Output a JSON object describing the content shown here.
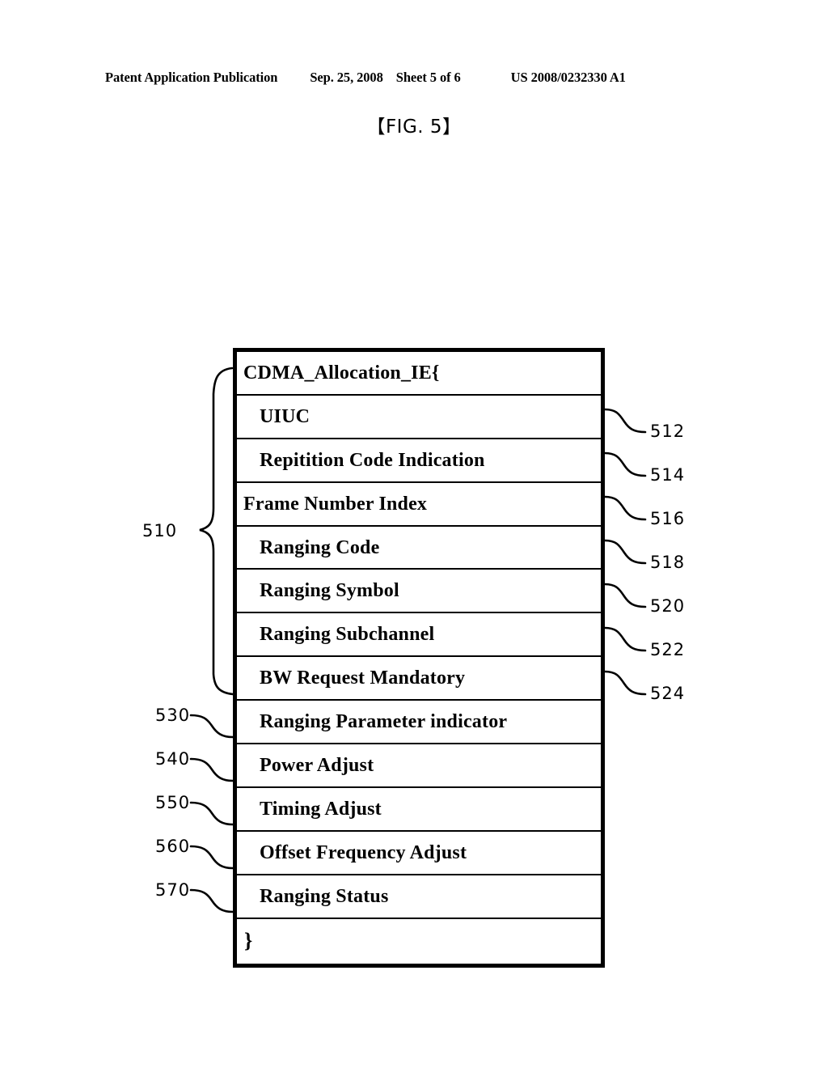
{
  "header": {
    "publication": "Patent Application Publication",
    "date": "Sep. 25, 2008",
    "sheet": "Sheet 5 of 6",
    "number": "US 2008/0232330 A1"
  },
  "figure": {
    "title": "【FIG. 5】"
  },
  "ie_box": {
    "rows": [
      {
        "label": "CDMA_Allocation_IE{",
        "indent": 0
      },
      {
        "label": "UIUC",
        "indent": 2
      },
      {
        "label": "Repitition Code Indication",
        "indent": 2
      },
      {
        "label": "Frame Number Index",
        "indent": 0
      },
      {
        "label": "Ranging Code",
        "indent": 2
      },
      {
        "label": "Ranging Symbol",
        "indent": 2
      },
      {
        "label": "Ranging Subchannel",
        "indent": 2
      },
      {
        "label": "BW Request Mandatory",
        "indent": 2
      },
      {
        "label": "Ranging Parameter indicator",
        "indent": 2
      },
      {
        "label": "Power Adjust",
        "indent": 2
      },
      {
        "label": "Timing Adjust",
        "indent": 2
      },
      {
        "label": "Offset Frequency Adjust",
        "indent": 2
      },
      {
        "label": "Ranging Status",
        "indent": 2
      },
      {
        "label": "}",
        "indent": 0
      }
    ]
  },
  "reference_numerals": {
    "left": [
      {
        "id": "510",
        "label": "510",
        "kind": "brace"
      },
      {
        "id": "530",
        "label": "530",
        "kind": "leader"
      },
      {
        "id": "540",
        "label": "540",
        "kind": "leader"
      },
      {
        "id": "550",
        "label": "550",
        "kind": "leader"
      },
      {
        "id": "560",
        "label": "560",
        "kind": "leader"
      },
      {
        "id": "570",
        "label": "570",
        "kind": "leader"
      }
    ],
    "right": [
      {
        "id": "512",
        "label": "512",
        "kind": "leader"
      },
      {
        "id": "514",
        "label": "514",
        "kind": "leader"
      },
      {
        "id": "516",
        "label": "516",
        "kind": "leader"
      },
      {
        "id": "518",
        "label": "518",
        "kind": "leader"
      },
      {
        "id": "520",
        "label": "520",
        "kind": "leader"
      },
      {
        "id": "522",
        "label": "522",
        "kind": "leader"
      },
      {
        "id": "524",
        "label": "524",
        "kind": "leader"
      }
    ]
  },
  "colors": {
    "ink": "#000000",
    "page": "#ffffff"
  }
}
